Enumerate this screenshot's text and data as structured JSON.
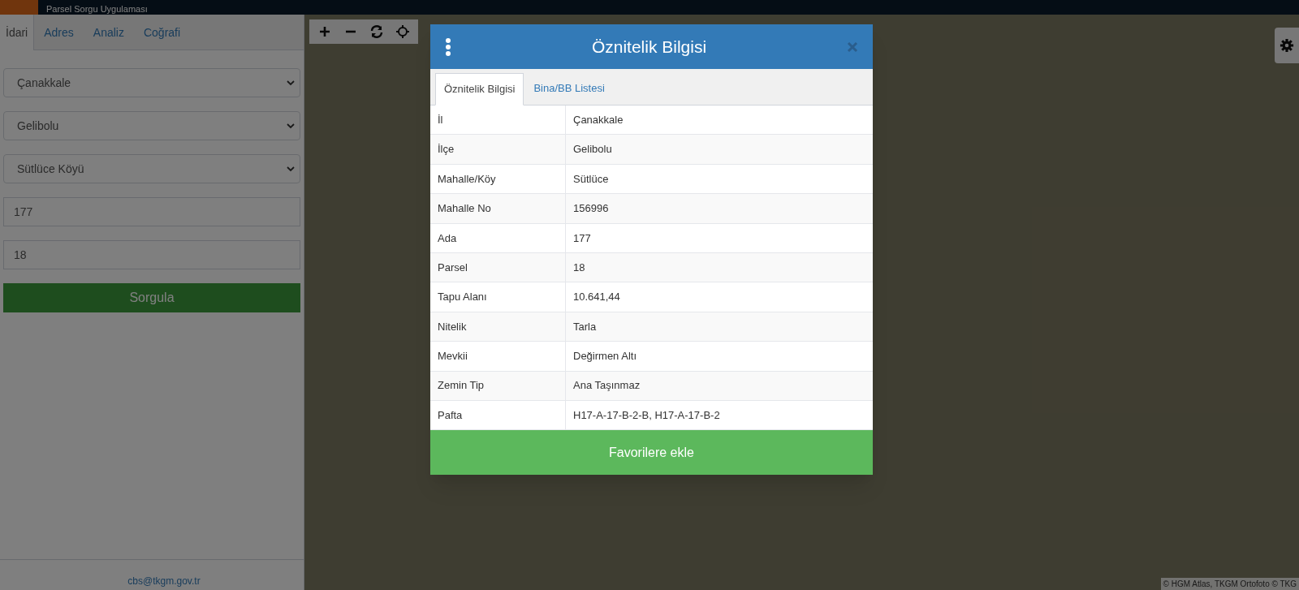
{
  "app_bar": {
    "title": "Parsel Sorgu Uygulaması"
  },
  "sidebar": {
    "tabs": [
      {
        "label": "İdari",
        "selected": true
      },
      {
        "label": "Adres",
        "selected": false
      },
      {
        "label": "Analiz",
        "selected": false
      },
      {
        "label": "Coğrafi",
        "selected": false
      }
    ],
    "fields": [
      {
        "kind": "select",
        "value": "Çanakkale"
      },
      {
        "kind": "select",
        "value": "Gelibolu"
      },
      {
        "kind": "select",
        "value": "Sütlüce Köyü"
      },
      {
        "kind": "input",
        "value": "177"
      },
      {
        "kind": "input",
        "value": "18"
      }
    ],
    "query_button": "Sorgula",
    "footer": "cbs@tkgm.gov.tr"
  },
  "map": {
    "attribution": "© HGM Atlas, TKGM Ortofoto © TKG"
  },
  "dialog": {
    "title": "Öznitelik Bilgisi",
    "tabs": [
      {
        "label": "Öznitelik Bilgisi",
        "selected": true
      },
      {
        "label": "Bina/BB Listesi",
        "selected": false
      }
    ],
    "rows": [
      [
        "İl",
        "Çanakkale"
      ],
      [
        "İlçe",
        "Gelibolu"
      ],
      [
        "Mahalle/Köy",
        "Sütlüce"
      ],
      [
        "Mahalle No",
        "156996"
      ],
      [
        "Ada",
        "177"
      ],
      [
        "Parsel",
        "18"
      ],
      [
        "Tapu Alanı",
        "10.641,44"
      ],
      [
        "Nitelik",
        "Tarla"
      ],
      [
        "Mevkii",
        "Değirmen Altı"
      ],
      [
        "Zemin Tip",
        "Ana Taşınmaz"
      ],
      [
        "Pafta",
        "H17-A-17-B-2-B, H17-A-17-B-2"
      ]
    ],
    "button": "Favorilere ekle"
  }
}
